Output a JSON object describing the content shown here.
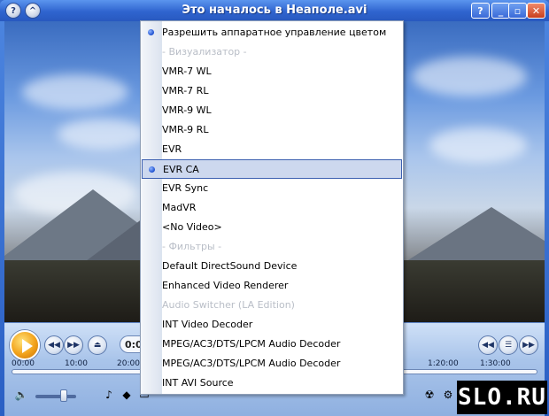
{
  "window": {
    "title": "Это началось в Неаполе.avi",
    "help_button": "?",
    "menu_button": "^",
    "controls": {
      "help_label": "?",
      "minimize_label": "_",
      "restore_label": "▫",
      "close_label": "✕"
    }
  },
  "player": {
    "current_time": "0:0",
    "timeline": [
      "00:00",
      "10:00",
      "20:00",
      "1:20:00",
      "1:30:00"
    ]
  },
  "context_menu": {
    "items": [
      {
        "label": "Разрешить аппаратное управление цветом",
        "state": "checked"
      },
      {
        "label": "- Визуализатор -",
        "state": "disabled"
      },
      {
        "label": "VMR-7 WL",
        "state": "normal"
      },
      {
        "label": "VMR-7 RL",
        "state": "normal"
      },
      {
        "label": "VMR-9 WL",
        "state": "normal"
      },
      {
        "label": "VMR-9 RL",
        "state": "normal"
      },
      {
        "label": "EVR",
        "state": "normal"
      },
      {
        "label": "EVR CA",
        "state": "selected"
      },
      {
        "label": "EVR Sync",
        "state": "normal"
      },
      {
        "label": "MadVR",
        "state": "normal"
      },
      {
        "label": "<No Video>",
        "state": "normal"
      },
      {
        "label": "- Фильтры -",
        "state": "disabled"
      },
      {
        "label": "Default DirectSound Device",
        "state": "normal"
      },
      {
        "label": "Enhanced Video Renderer",
        "state": "normal"
      },
      {
        "label": "Audio Switcher (LA Edition)",
        "state": "disabled"
      },
      {
        "label": "INT Video Decoder",
        "state": "normal"
      },
      {
        "label": "MPEG/AC3/DTS/LPCM Audio Decoder",
        "state": "normal"
      },
      {
        "label": "MPEG/AC3/DTS/LPCM Audio Decoder",
        "state": "normal"
      },
      {
        "label": "INT AVI Source",
        "state": "normal"
      }
    ]
  },
  "watermark": {
    "text": "SLO.RU"
  }
}
